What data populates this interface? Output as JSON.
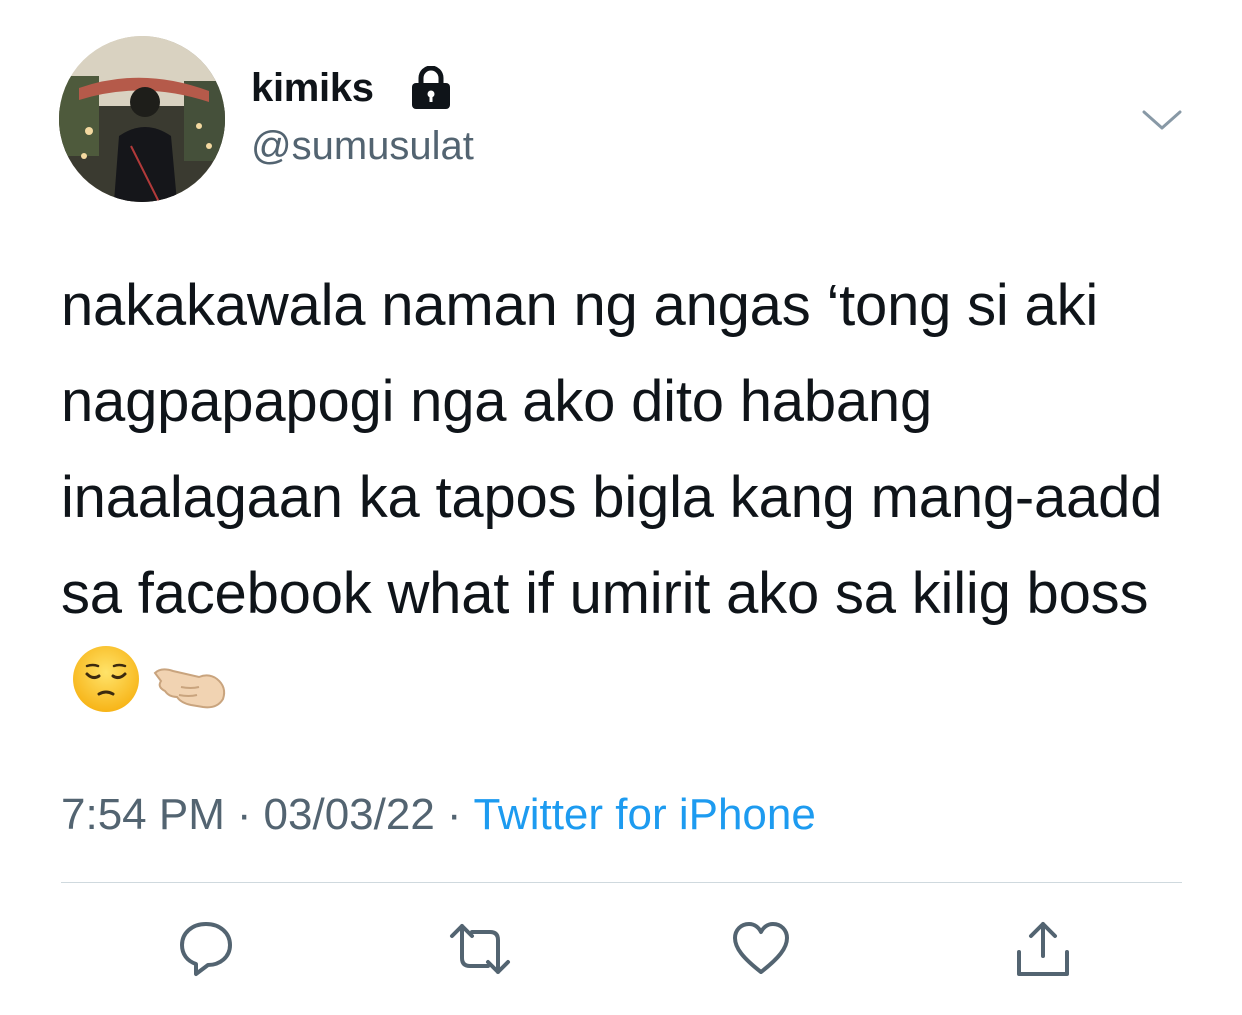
{
  "author": {
    "display_name": "kimiks",
    "handle": "@sumusulat",
    "protected_icon": "lock-icon",
    "avatar": "profile-photo"
  },
  "tweet": {
    "text": "nakakawala naman ng angas ‘tong si aki nagpapapogi nga ako dito habang inaalagaan ka tapos bigla kang mang-aadd sa facebook what if umirit ako sa kilig boss",
    "emoji": [
      "pensive-face-emoji",
      "pointing-left-hand-emoji"
    ]
  },
  "meta": {
    "time": "7:54 PM",
    "date": "03/03/22",
    "separator": "·",
    "source": "Twitter for iPhone"
  },
  "actions": {
    "reply": "reply-icon",
    "retweet": "retweet-icon",
    "like": "like-icon",
    "share": "share-icon"
  },
  "colors": {
    "text": "#0f1419",
    "secondary": "#536471",
    "link": "#1d9bf0",
    "divider": "#cfd9de"
  }
}
